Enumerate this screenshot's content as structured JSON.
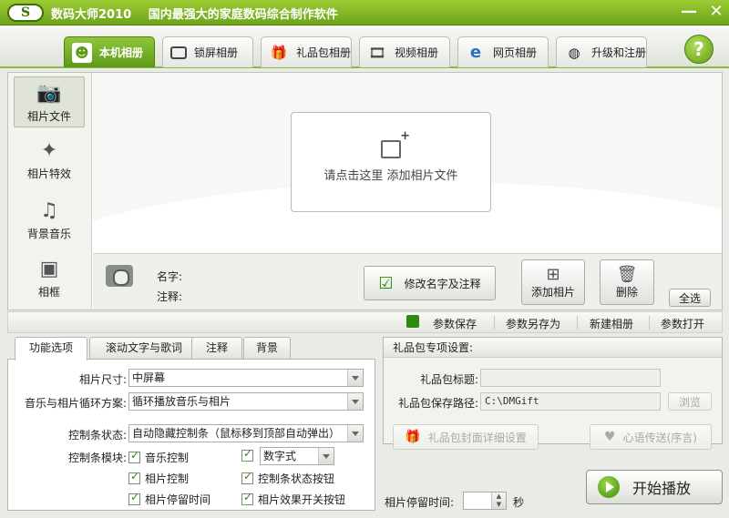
{
  "window": {
    "app_name": "数码大师2010",
    "subtitle": "国内最强大的家庭数码综合制作软件",
    "logo_text": "S",
    "minimize": "—",
    "close": "✕"
  },
  "top_tabs": [
    {
      "label": "本机相册",
      "icon": "person-photo-icon"
    },
    {
      "label": "锁屏相册",
      "icon": "monitor-icon"
    },
    {
      "label": "礼品包相册",
      "icon": "gift-icon"
    },
    {
      "label": "视频相册",
      "icon": "film-icon"
    },
    {
      "label": "网页相册",
      "icon": "ie-icon"
    },
    {
      "label": "升级和注册",
      "icon": "globe-icon"
    }
  ],
  "help_label": "?",
  "left_nav": [
    {
      "label": "相片文件",
      "icon": "camera-icon"
    },
    {
      "label": "相片特效",
      "icon": "effects-icon"
    },
    {
      "label": "背景音乐",
      "icon": "music-note-icon"
    },
    {
      "label": "相框",
      "icon": "frame-icon"
    }
  ],
  "drop_zone": {
    "text": "请点击这里  添加相片文件"
  },
  "info": {
    "name_label": "名字:",
    "note_label": "注释:",
    "edit_button": "修改名字及注释",
    "add_button": "添加相片",
    "delete_button": "删除",
    "select_all_button": "全选"
  },
  "toolbar": {
    "save_params": "参数保存",
    "save_as": "参数另存为",
    "new_album": "新建相册",
    "open_params": "参数打开"
  },
  "bottom_tabs": [
    "功能选项",
    "滚动文字与歌词",
    "注释",
    "背景"
  ],
  "options": {
    "photo_size_label": "相片尺寸:",
    "photo_size_value": "中屏幕",
    "loop_label": "音乐与相片循环方案:",
    "loop_value": "循环播放音乐与相片",
    "control_status_label": "控制条状态:",
    "control_status_value": "自动隐藏控制条（鼠标移到顶部自动弹出）",
    "control_module_label": "控制条模块:",
    "checkboxes": {
      "music_control": "音乐控制",
      "number_style": "数字式",
      "photo_control": "相片控制",
      "status_button": "控制条状态按钮",
      "photo_stay_time": "相片停留时间",
      "effect_toggle": "相片效果开关按钮"
    }
  },
  "gift": {
    "header": "礼品包专项设置:",
    "title_label": "礼品包标题:",
    "title_value": "",
    "path_label": "礼品包保存路径:",
    "path_value": "C:\\DMGift",
    "browse": "浏览",
    "cover_button": "礼品包封面详细设置",
    "message_button": "心语传送(序言)"
  },
  "stay_time": {
    "label": "相片停留时间:",
    "value": "",
    "unit": "秒"
  },
  "play_button": "开始播放",
  "colors": {
    "accent_green": "#6ea31a",
    "tab_active": "#5f9a17"
  }
}
